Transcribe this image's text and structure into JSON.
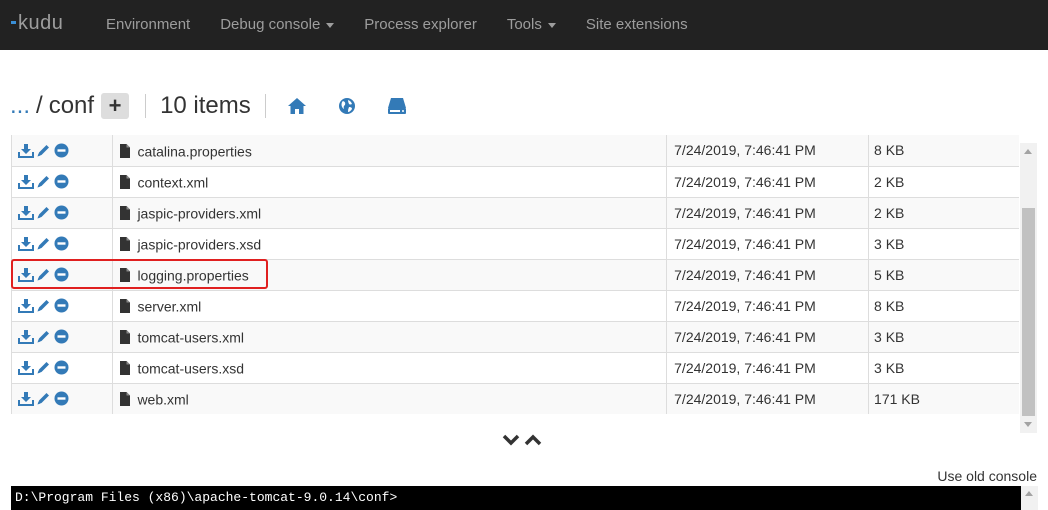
{
  "nav": {
    "brand": "kudu",
    "items": [
      {
        "label": "Environment",
        "dropdown": false
      },
      {
        "label": "Debug console",
        "dropdown": true
      },
      {
        "label": "Process explorer",
        "dropdown": false
      },
      {
        "label": "Tools",
        "dropdown": true
      },
      {
        "label": "Site extensions",
        "dropdown": false
      }
    ]
  },
  "toolbar": {
    "ellipsis": "...",
    "separator": "/",
    "folder": "conf",
    "add_label": "+",
    "item_count": "10 items"
  },
  "files": [
    {
      "name": "catalina.properties",
      "modified": "7/24/2019, 7:46:41 PM",
      "size": "8 KB"
    },
    {
      "name": "context.xml",
      "modified": "7/24/2019, 7:46:41 PM",
      "size": "2 KB"
    },
    {
      "name": "jaspic-providers.xml",
      "modified": "7/24/2019, 7:46:41 PM",
      "size": "2 KB"
    },
    {
      "name": "jaspic-providers.xsd",
      "modified": "7/24/2019, 7:46:41 PM",
      "size": "3 KB"
    },
    {
      "name": "logging.properties",
      "modified": "7/24/2019, 7:46:41 PM",
      "size": "5 KB"
    },
    {
      "name": "server.xml",
      "modified": "7/24/2019, 7:46:41 PM",
      "size": "8 KB"
    },
    {
      "name": "tomcat-users.xml",
      "modified": "7/24/2019, 7:46:41 PM",
      "size": "3 KB"
    },
    {
      "name": "tomcat-users.xsd",
      "modified": "7/24/2019, 7:46:41 PM",
      "size": "3 KB"
    },
    {
      "name": "web.xml",
      "modified": "7/24/2019, 7:46:41 PM",
      "size": "171 KB"
    }
  ],
  "highlighted_file": "logging.properties",
  "console": {
    "old_console_label": "Use old console",
    "prompt": "D:\\Program Files (x86)\\apache-tomcat-9.0.14\\conf>"
  },
  "colors": {
    "navbar_bg": "#222222",
    "nav_text": "#9d9d9d",
    "accent_blue": "#337ab7",
    "highlight_red": "#e02020"
  },
  "icons": {
    "row_actions": [
      "download-icon",
      "edit-icon",
      "delete-icon"
    ],
    "file": "file-icon",
    "toolbar": [
      "home-icon",
      "globe-icon",
      "drive-icon"
    ]
  }
}
